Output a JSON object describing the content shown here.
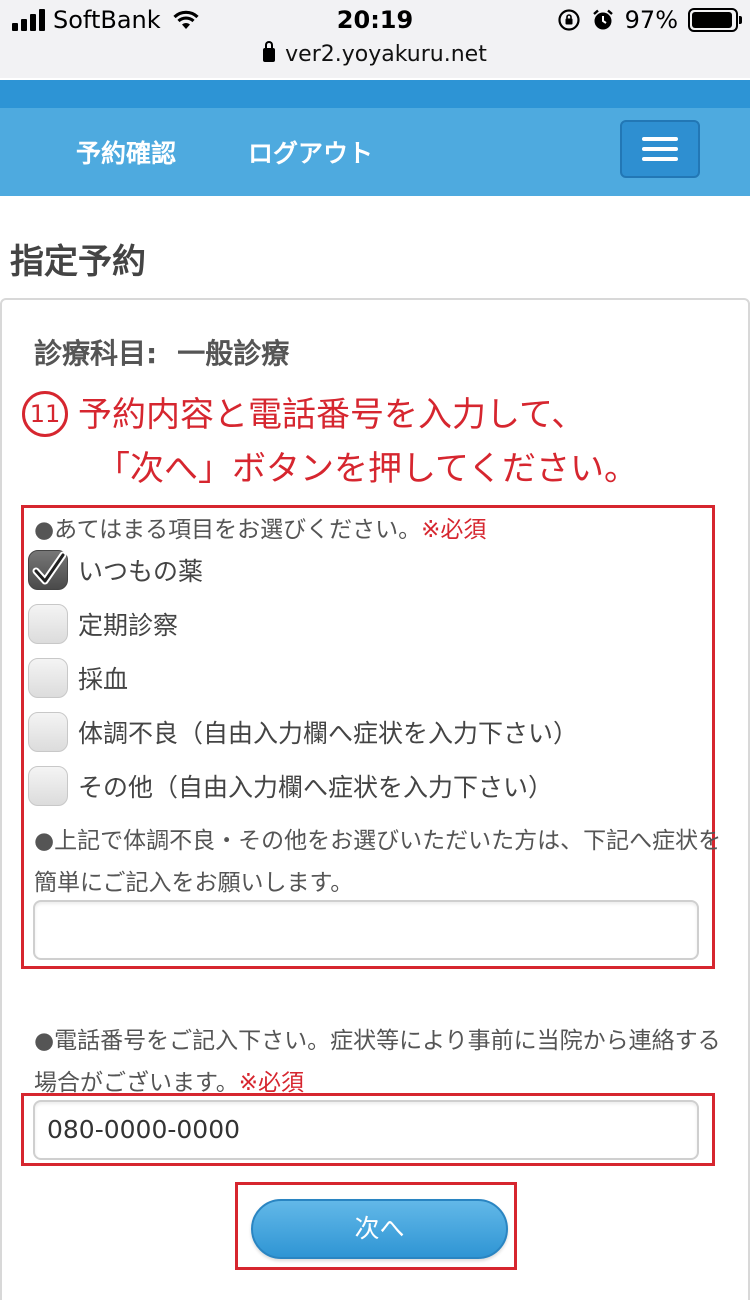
{
  "status_bar": {
    "carrier": "SoftBank",
    "time": "20:19",
    "battery": "97%",
    "url": "ver2.yoyakuru.net"
  },
  "nav": {
    "reserve_check": "予約確認",
    "logout": "ログアウト"
  },
  "page": {
    "title": "指定予約",
    "department_label": "診療科目:",
    "department_value": "一般診療"
  },
  "annotation": {
    "number": "11",
    "line1": "予約内容と電話番号を入力して、",
    "line2": "「次へ」ボタンを押してください。"
  },
  "form": {
    "question1": "●あてはまる項目をお選びください。",
    "required": "※必須",
    "options": [
      {
        "label": "いつもの薬",
        "checked": true
      },
      {
        "label": "定期診察",
        "checked": false
      },
      {
        "label": "採血",
        "checked": false
      },
      {
        "label": "体調不良（自由入力欄へ症状を入力下さい）",
        "checked": false
      },
      {
        "label": "その他（自由入力欄へ症状を入力下さい）",
        "checked": false
      }
    ],
    "question2": "●上記で体調不良・その他をお選びいただいた方は、下記へ症状を簡単にご記入をお願いします。",
    "symptom_value": "",
    "question3": "●電話番号をご記入下さい。症状等により事前に当院から連絡する場合がございます。",
    "phone_value": "080-0000-0000",
    "next_button": "次へ"
  },
  "colors": {
    "nav_blue": "#4eaadf",
    "top_band": "#2d94d5",
    "annotation_red": "#d6262f",
    "button_blue": "#2f95d4"
  }
}
